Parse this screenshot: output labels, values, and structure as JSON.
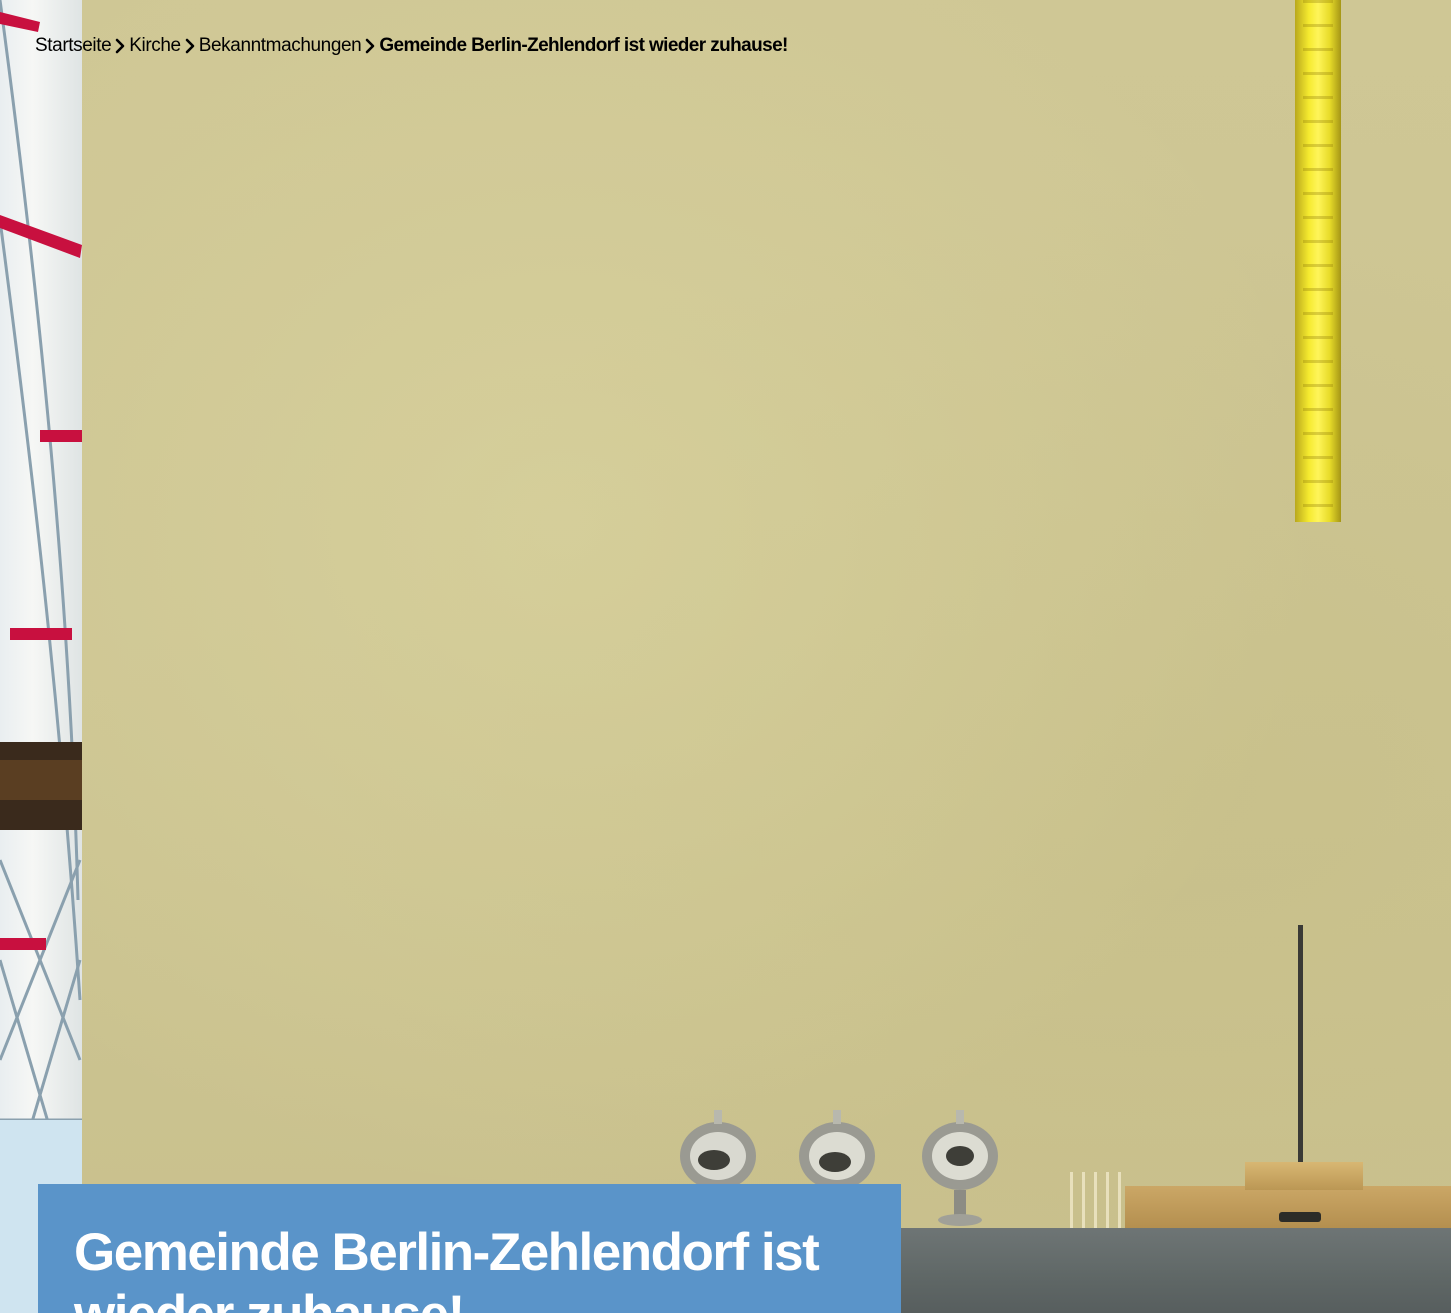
{
  "breadcrumb": {
    "items": [
      {
        "label": "Startseite"
      },
      {
        "label": "Kirche"
      },
      {
        "label": "Bekanntmachungen"
      }
    ],
    "current": "Gemeinde Berlin-Zehlendorf ist wieder zuhause!",
    "separator_icon": "chevron-right-icon"
  },
  "hero": {
    "title": "Gemeinde Berlin-Zehlendorf ist wieder zuhause!"
  },
  "colors": {
    "title_card": "#5a94c9",
    "wall": "#cdc593",
    "banner": "#f2e62e",
    "altar": "#636a6a"
  }
}
